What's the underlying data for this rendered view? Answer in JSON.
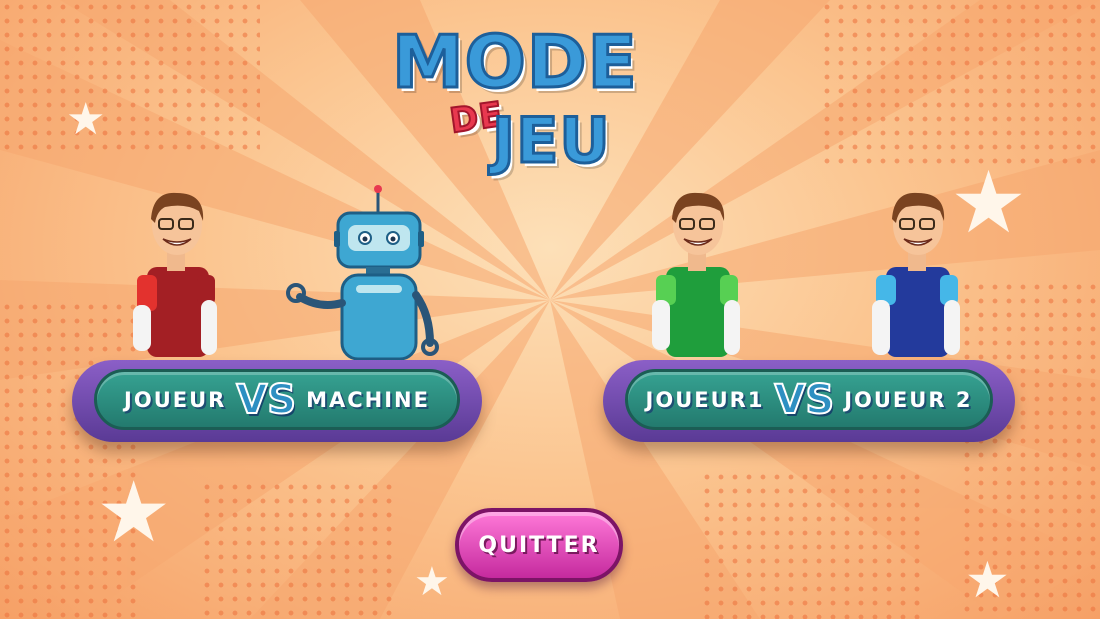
{
  "title": {
    "line1": "MODE",
    "line2": "DE",
    "line3": "JEU"
  },
  "modes": [
    {
      "left_label": "JOUEUR",
      "vs_label": "VS",
      "right_label": "MACHINE"
    },
    {
      "left_label": "JOUEUR1",
      "vs_label": "VS",
      "right_label": "JOUEUR 2"
    }
  ],
  "quit_label": "QUITTER",
  "colors": {
    "background": "#fbc590",
    "platform_border": "#6b45a8",
    "platform_fill": "#2f8f82",
    "quit_button": "#e14fbf",
    "title_blue": "#3a9ad9",
    "title_red": "#e8384f"
  },
  "characters": [
    {
      "icon": "boy-red-shirt-icon"
    },
    {
      "icon": "robot-icon"
    },
    {
      "icon": "boy-green-shirt-icon"
    },
    {
      "icon": "boy-blue-shirt-icon"
    }
  ]
}
